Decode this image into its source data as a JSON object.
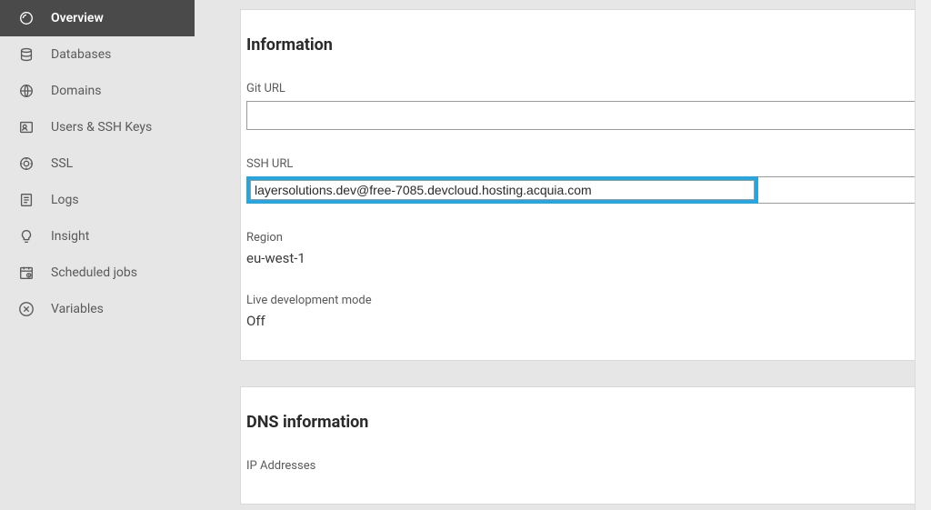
{
  "sidebar": {
    "items": [
      {
        "label": "Overview",
        "icon": "overview-icon",
        "active": true
      },
      {
        "label": "Databases",
        "icon": "database-icon",
        "active": false
      },
      {
        "label": "Domains",
        "icon": "globe-icon",
        "active": false
      },
      {
        "label": "Users & SSH Keys",
        "icon": "user-icon",
        "active": false
      },
      {
        "label": "SSL",
        "icon": "ssl-icon",
        "active": false
      },
      {
        "label": "Logs",
        "icon": "logs-icon",
        "active": false
      },
      {
        "label": "Insight",
        "icon": "bulb-icon",
        "active": false
      },
      {
        "label": "Scheduled jobs",
        "icon": "calendar-icon",
        "active": false
      },
      {
        "label": "Variables",
        "icon": "variable-icon",
        "active": false
      }
    ]
  },
  "information": {
    "heading": "Information",
    "git_url_label": "Git URL",
    "git_url_value": "",
    "ssh_url_label": "SSH URL",
    "ssh_url_value": "layersolutions.dev@free-7085.devcloud.hosting.acquia.com",
    "region_label": "Region",
    "region_value": "eu-west-1",
    "livedev_label": "Live development mode",
    "livedev_value": "Off"
  },
  "dns": {
    "heading": "DNS information",
    "ip_label": "IP Addresses"
  }
}
